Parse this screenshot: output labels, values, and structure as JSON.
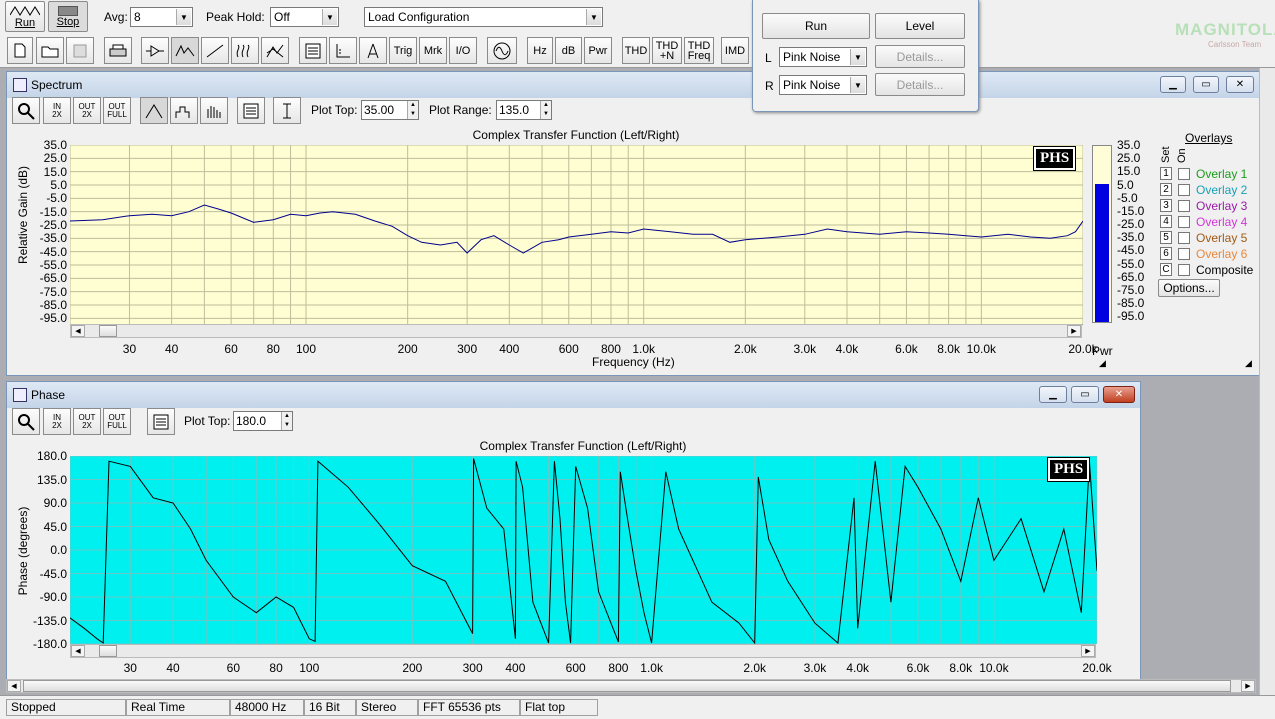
{
  "toolbar": {
    "run_label": "Run",
    "stop_label": "Stop",
    "avg_label": "Avg:",
    "avg_value": "8",
    "peak_hold_label": "Peak Hold:",
    "peak_hold_value": "Off",
    "load_config": "Load Configuration",
    "tools": [
      "new",
      "open",
      "save",
      "print"
    ],
    "mid_buttons": [
      "Trig",
      "Mrk",
      "I/O"
    ],
    "right_buttons": [
      {
        "l1": "Hz",
        "l2": ""
      },
      {
        "l1": "dB",
        "l2": ""
      },
      {
        "l1": "Pwr",
        "l2": ""
      },
      {
        "l1": "THD",
        "l2": ""
      },
      {
        "l1": "THD",
        "l2": "+N"
      },
      {
        "l1": "THD",
        "l2": "Freq"
      },
      {
        "l1": "IMD",
        "l2": ""
      }
    ]
  },
  "generator": {
    "run": "Run",
    "level": "Level",
    "l": "L",
    "r": "R",
    "l_signal": "Pink Noise",
    "r_signal": "Pink Noise",
    "details": "Details...",
    "logo": "MAGNITOLA",
    "logo_sub": "Carlsson Team"
  },
  "spectrum": {
    "title": "Spectrum",
    "plot_top_label": "Plot Top:",
    "plot_top": "35.00",
    "plot_range_label": "Plot Range:",
    "plot_range": "135.0",
    "zoom_labels": [
      {
        "a": "IN",
        "b": "2X"
      },
      {
        "a": "OUT",
        "b": "2X"
      },
      {
        "a": "OUT",
        "b": "FULL"
      }
    ],
    "badge": "PHS",
    "pwr": "Pwr",
    "bar_level_db": 5.0,
    "overlays_title": "Overlays",
    "set": "Set",
    "on": "On",
    "overlays": [
      {
        "num": "1",
        "name": "Overlay 1",
        "color": "#1c9c1c"
      },
      {
        "num": "2",
        "name": "Overlay 2",
        "color": "#18a0b8"
      },
      {
        "num": "3",
        "name": "Overlay 3",
        "color": "#9a1aa8"
      },
      {
        "num": "4",
        "name": "Overlay 4",
        "color": "#d236d8"
      },
      {
        "num": "5",
        "name": "Overlay 5",
        "color": "#a05a14"
      },
      {
        "num": "6",
        "name": "Overlay 6",
        "color": "#e8883c"
      },
      {
        "num": "C",
        "name": "Composite",
        "color": "#000000"
      }
    ],
    "options": "Options...",
    "bar_ticks": [
      "35.0",
      "25.0",
      "15.0",
      "5.0",
      "-5.0",
      "-15.0",
      "-25.0",
      "-35.0",
      "-45.0",
      "-55.0",
      "-65.0",
      "-75.0",
      "-85.0",
      "-95.0"
    ]
  },
  "phase": {
    "title": "Phase",
    "plot_top_label": "Plot Top:",
    "plot_top": "180.0",
    "badge": "PHS"
  },
  "chart_data": [
    {
      "type": "line",
      "title": "Complex Transfer Function (Left/Right)",
      "xlabel": "Frequency (Hz)",
      "ylabel": "Relative Gain (dB)",
      "xscale": "log",
      "xlim": [
        20,
        20000
      ],
      "ylim": [
        -100,
        35
      ],
      "yticks": [
        "35.0",
        "25.0",
        "15.0",
        "5.0",
        "-5.0",
        "-15.0",
        "-25.0",
        "-35.0",
        "-45.0",
        "-55.0",
        "-65.0",
        "-75.0",
        "-85.0",
        "-95.0"
      ],
      "xticks": [
        {
          "v": 30,
          "t": "30"
        },
        {
          "v": 40,
          "t": "40"
        },
        {
          "v": 60,
          "t": "60"
        },
        {
          "v": 80,
          "t": "80"
        },
        {
          "v": 100,
          "t": "100"
        },
        {
          "v": 200,
          "t": "200"
        },
        {
          "v": 300,
          "t": "300"
        },
        {
          "v": 400,
          "t": "400"
        },
        {
          "v": 600,
          "t": "600"
        },
        {
          "v": 800,
          "t": "800"
        },
        {
          "v": 1000,
          "t": "1.0k"
        },
        {
          "v": 2000,
          "t": "2.0k"
        },
        {
          "v": 3000,
          "t": "3.0k"
        },
        {
          "v": 4000,
          "t": "4.0k"
        },
        {
          "v": 6000,
          "t": "6.0k"
        },
        {
          "v": 8000,
          "t": "8.0k"
        },
        {
          "v": 10000,
          "t": "10.0k"
        },
        {
          "v": 20000,
          "t": "20.0k"
        }
      ],
      "series": [
        {
          "x": [
            20,
            25,
            30,
            35,
            40,
            45,
            50,
            55,
            60,
            70,
            80,
            90,
            100,
            110,
            120,
            140,
            160,
            180,
            200,
            220,
            250,
            280,
            300,
            330,
            360,
            400,
            440,
            500,
            560,
            600,
            700,
            800,
            900,
            1000,
            1200,
            1400,
            1600,
            1800,
            2000,
            2500,
            3000,
            3500,
            4000,
            5000,
            6000,
            7000,
            8000,
            9000,
            10000,
            12000,
            14000,
            16000,
            18000,
            19000,
            20000
          ],
          "y": [
            -22,
            -21,
            -18,
            -17,
            -18,
            -15,
            -10,
            -13,
            -16,
            -23,
            -21,
            -17,
            -18,
            -16,
            -15,
            -17,
            -22,
            -26,
            -33,
            -38,
            -40,
            -38,
            -46,
            -36,
            -33,
            -40,
            -46,
            -38,
            -36,
            -34,
            -32,
            -30,
            -31,
            -28,
            -30,
            -32,
            -32,
            -38,
            -36,
            -34,
            -32,
            -28,
            -30,
            -32,
            -30,
            -31,
            -32,
            -33,
            -34,
            -32,
            -34,
            -35,
            -33,
            -30,
            -22
          ]
        }
      ]
    },
    {
      "type": "line",
      "title": "Complex Transfer Function (Left/Right)",
      "xlabel": "",
      "ylabel": "Phase (degrees)",
      "xscale": "log",
      "xlim": [
        20,
        20000
      ],
      "ylim": [
        -180,
        180
      ],
      "yticks": [
        "180.0",
        "135.0",
        "90.0",
        "45.0",
        "0.0",
        "-45.0",
        "-90.0",
        "-135.0",
        "-180.0"
      ],
      "xticks": [
        {
          "v": 30,
          "t": "30"
        },
        {
          "v": 40,
          "t": "40"
        },
        {
          "v": 60,
          "t": "60"
        },
        {
          "v": 80,
          "t": "80"
        },
        {
          "v": 100,
          "t": "100"
        },
        {
          "v": 200,
          "t": "200"
        },
        {
          "v": 300,
          "t": "300"
        },
        {
          "v": 400,
          "t": "400"
        },
        {
          "v": 600,
          "t": "600"
        },
        {
          "v": 800,
          "t": "800"
        },
        {
          "v": 1000,
          "t": "1.0k"
        },
        {
          "v": 2000,
          "t": "2.0k"
        },
        {
          "v": 3000,
          "t": "3.0k"
        },
        {
          "v": 4000,
          "t": "4.0k"
        },
        {
          "v": 6000,
          "t": "6.0k"
        },
        {
          "v": 8000,
          "t": "8.0k"
        },
        {
          "v": 10000,
          "t": "10.0k"
        },
        {
          "v": 20000,
          "t": "20.0k"
        }
      ],
      "series": [
        {
          "x": [
            20,
            22,
            24,
            25,
            26,
            30,
            35,
            40,
            45,
            50,
            60,
            70,
            80,
            90,
            100,
            104,
            106,
            130,
            160,
            200,
            250,
            300,
            302,
            330,
            370,
            400,
            402,
            420,
            450,
            500,
            520,
            540,
            560,
            580,
            600,
            650,
            700,
            800,
            810,
            850,
            900,
            950,
            1000,
            1100,
            1200,
            1500,
            1800,
            2000,
            2050,
            2200,
            2500,
            3000,
            3500,
            3900,
            4000,
            4500,
            5000,
            5500,
            6000,
            7000,
            8000,
            9000,
            10000,
            12000,
            14000,
            16000,
            18000,
            19000,
            20000
          ],
          "y": [
            -130,
            -150,
            -170,
            -178,
            170,
            160,
            100,
            90,
            40,
            -20,
            -90,
            -120,
            -90,
            -110,
            -170,
            -175,
            170,
            120,
            50,
            -30,
            -60,
            -160,
            175,
            80,
            40,
            -170,
            170,
            120,
            -100,
            -178,
            170,
            60,
            -100,
            -178,
            160,
            80,
            -80,
            -176,
            150,
            60,
            -40,
            -120,
            -178,
            150,
            40,
            -100,
            -140,
            -178,
            140,
            20,
            -60,
            -140,
            -178,
            100,
            -150,
            170,
            -100,
            160,
            120,
            40,
            -60,
            100,
            -20,
            60,
            -80,
            40,
            -120,
            170,
            -40
          ]
        }
      ]
    }
  ],
  "status": {
    "stopped": "Stopped",
    "mode": "Real Time",
    "rate": "48000 Hz",
    "bits": "16 Bit",
    "channels": "Stereo",
    "fft": "FFT 65536 pts",
    "window": "Flat top"
  }
}
